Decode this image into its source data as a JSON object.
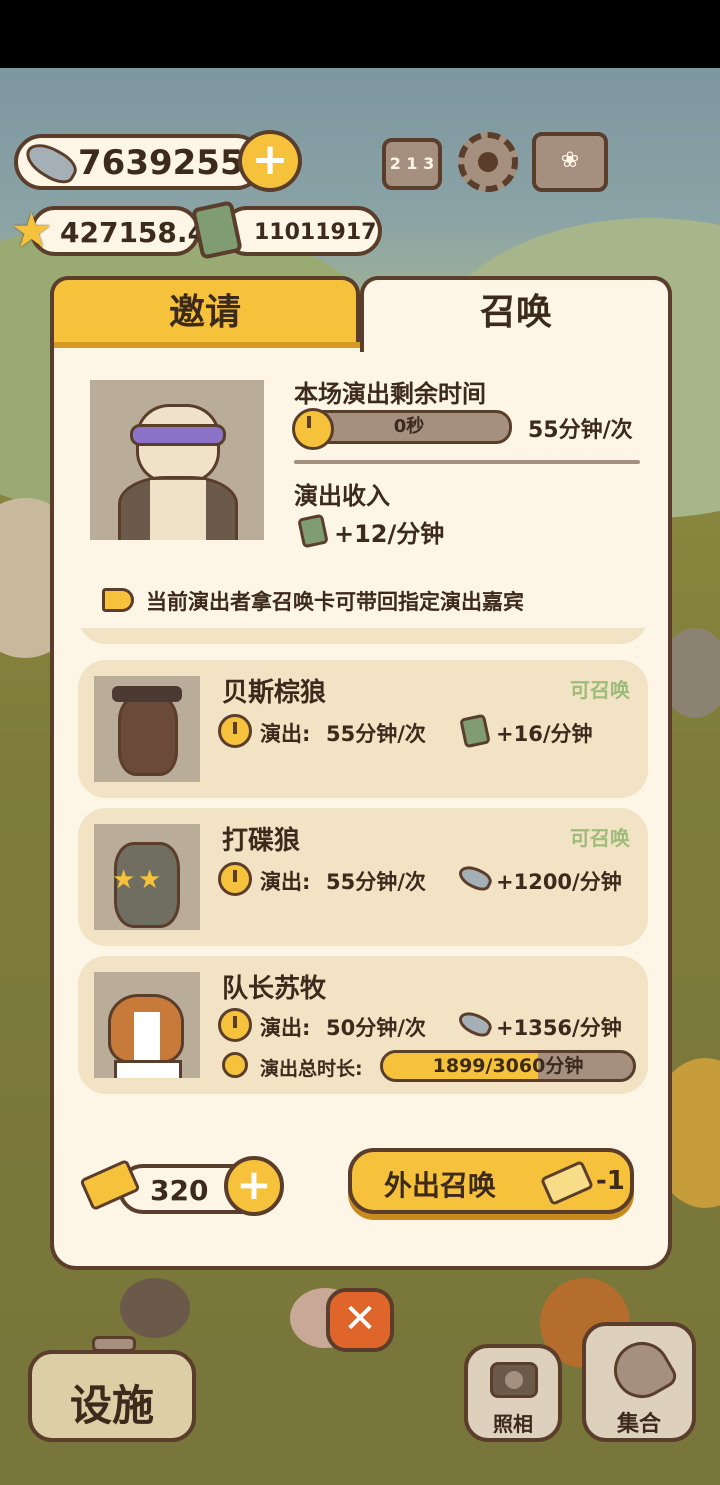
{
  "hud": {
    "fish_amount": "76392550",
    "star_amount": "427158.4",
    "cash_amount": "11011917",
    "ranking_digits": "2 1 3"
  },
  "tabs": {
    "invite": "邀请",
    "summon": "召唤"
  },
  "current": {
    "time_label": "本场演出剩余时间",
    "remaining": "0秒",
    "remaining_fraction": 0,
    "rate": "55分钟/次",
    "income_label": "演出收入",
    "income_value": "+12/分钟"
  },
  "notice": "当前演出者拿召唤卡可带回指定演出嘉宾",
  "guests": [
    {
      "name": "贝斯棕狼",
      "status": "可召唤",
      "perf_label": "演出:",
      "perf_value": "55分钟/次",
      "income_icon": "cash-icon",
      "income_value": "+16/分钟"
    },
    {
      "name": "打碟狼",
      "status": "可召唤",
      "perf_label": "演出:",
      "perf_value": "55分钟/次",
      "income_icon": "fish-icon",
      "income_value": "+1200/分钟"
    },
    {
      "name": "队长苏牧",
      "status": "",
      "perf_label": "演出:",
      "perf_value": "50分钟/次",
      "income_icon": "fish-icon",
      "income_value": "+1356/分钟",
      "total_label": "演出总时长:",
      "total_value": "1899/3060分钟",
      "total_fraction": 0.62
    }
  ],
  "footer": {
    "ticket_count": "320",
    "summon_button": "外出召唤",
    "summon_cost": "-1"
  },
  "bottom": {
    "facilities": "设施",
    "photo": "照相",
    "gather": "集合",
    "close_symbol": "✕"
  },
  "colors": {
    "accent_yellow": "#f6c23c",
    "outline_brown": "#5a3e2b",
    "panel_cream": "#fdf6e7",
    "card_beige": "#f1e3c4",
    "summonable_green": "#9fbb7b"
  }
}
